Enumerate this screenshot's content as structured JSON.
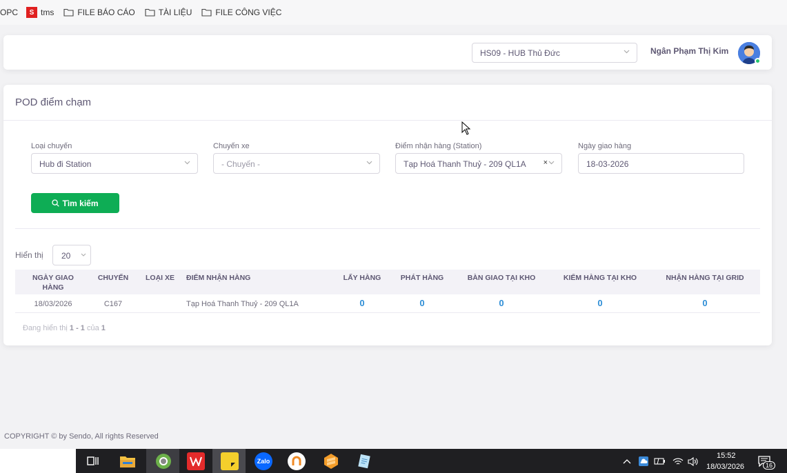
{
  "bookmarks": [
    {
      "label": "OPC"
    },
    {
      "label": "tms"
    },
    {
      "label": "FILE BÁO CÁO"
    },
    {
      "label": "TÀI LIỆU"
    },
    {
      "label": "FILE CÔNG VIỆC"
    }
  ],
  "header": {
    "hub_select": "HS09 - HUB Thủ Đức",
    "user_name": "Ngân Phạm Thị Kim"
  },
  "page": {
    "title": "POD điểm chạm",
    "filters": {
      "trip_type": {
        "label": "Loại chuyến",
        "value": "Hub đi Station"
      },
      "trip": {
        "label": "Chuyến xe",
        "placeholder": "- Chuyến -"
      },
      "station": {
        "label": "Điểm nhận hàng (Station)",
        "value": "Tạp Hoá Thanh Thuỷ - 209 QL1A"
      },
      "date": {
        "label": "Ngày giao hàng",
        "value": "18-03-2026"
      }
    },
    "search_button": "Tìm kiếm",
    "show_label": "Hiển thị",
    "page_size": "20",
    "table": {
      "headers": [
        "NGÀY GIAO HÀNG",
        "CHUYẾN",
        "LOẠI XE",
        "ĐIỂM NHẬN HÀNG",
        "LẤY HÀNG",
        "PHÁT HÀNG",
        "BÀN GIAO TẠI KHO",
        "KIỂM HÀNG TẠI KHO",
        "NHẬN HÀNG TẠI GRID"
      ],
      "rows": [
        [
          "18/03/2026",
          "C167",
          "",
          "Tạp Hoá Thanh Thuỷ - 209 QL1A",
          "0",
          "0",
          "0",
          "0",
          "0"
        ]
      ]
    },
    "pager": {
      "prefix": "Đang hiển thị",
      "range": "1 - 1",
      "of": "của",
      "total": "1"
    }
  },
  "footer": {
    "copyright": "COPYRIGHT © by Sendo, All rights Reserved"
  },
  "taskbar": {
    "time": "15:52",
    "date": "18/03/2026",
    "notification_count": "16",
    "apps": [
      "task-view",
      "file-explorer",
      "chrome",
      "wps-office",
      "sticky-notes",
      "zalo",
      "ultraviewer",
      "sublime-text",
      "notepad"
    ]
  },
  "colors": {
    "accent_green": "#0ead55",
    "value_blue": "#2e8ed6",
    "taskbar": "#1f1f22"
  }
}
